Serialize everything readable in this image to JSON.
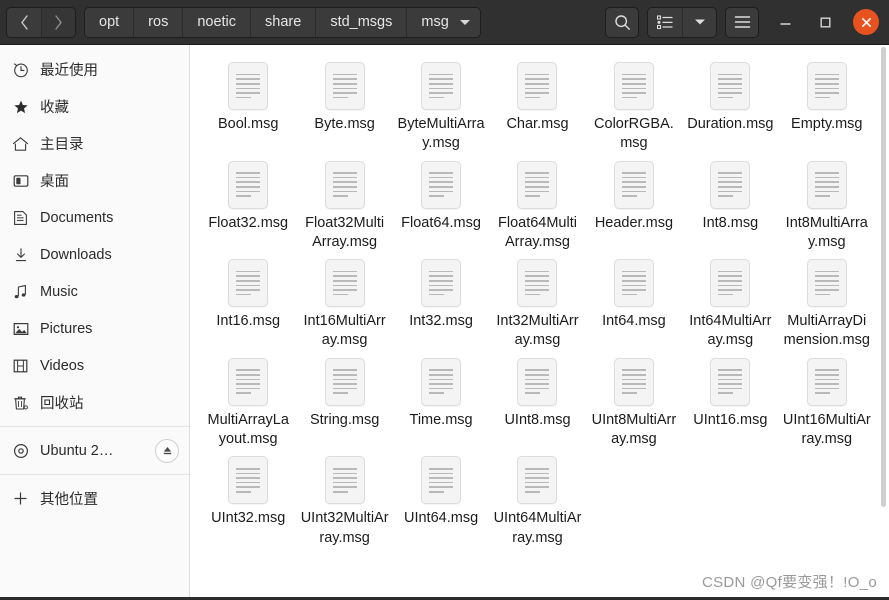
{
  "window": {
    "title": "msg",
    "nav": {
      "back_label": "‹",
      "forward_label": "›"
    },
    "breadcrumb": [
      "opt",
      "ros",
      "noetic",
      "share",
      "std_msgs",
      "msg"
    ],
    "toolbar": {
      "search_icon": "search-icon",
      "view_list_icon": "view-list-icon",
      "view_dropdown_icon": "chevron-down-icon",
      "menu_icon": "hamburger-menu-icon"
    },
    "controls": {
      "minimize": "–",
      "maximize": "□",
      "close": "✕"
    },
    "accent_color": "#e8521f",
    "headerbar_color": "#303030"
  },
  "sidebar": {
    "items": [
      {
        "label": "最近使用",
        "icon": "clock-icon"
      },
      {
        "label": "收藏",
        "icon": "star-icon"
      },
      {
        "label": "主目录",
        "icon": "home-icon"
      },
      {
        "label": "桌面",
        "icon": "desktop-icon"
      },
      {
        "label": "Documents",
        "icon": "documents-icon"
      },
      {
        "label": "Downloads",
        "icon": "download-icon"
      },
      {
        "label": "Music",
        "icon": "music-note-icon"
      },
      {
        "label": "Pictures",
        "icon": "picture-icon"
      },
      {
        "label": "Videos",
        "icon": "video-film-icon"
      },
      {
        "label": "回收站",
        "icon": "trash-icon"
      }
    ],
    "devices": [
      {
        "label": "Ubuntu 2…",
        "icon": "disc-icon",
        "eject": "eject-icon"
      }
    ],
    "other": {
      "label": "其他位置",
      "icon": "plus-icon"
    }
  },
  "files": [
    "Bool.msg",
    "Byte.msg",
    "ByteMultiArray.msg",
    "Char.msg",
    "ColorRGBA.msg",
    "Duration.msg",
    "Empty.msg",
    "Float32.msg",
    "Float32MultiArray.msg",
    "Float64.msg",
    "Float64MultiArray.msg",
    "Header.msg",
    "Int8.msg",
    "Int8MultiArray.msg",
    "Int16.msg",
    "Int16MultiArray.msg",
    "Int32.msg",
    "Int32MultiArray.msg",
    "Int64.msg",
    "Int64MultiArray.msg",
    "MultiArrayDimension.msg",
    "MultiArrayLayout.msg",
    "String.msg",
    "Time.msg",
    "UInt8.msg",
    "UInt8MultiArray.msg",
    "UInt16.msg",
    "UInt16MultiArray.msg",
    "UInt32.msg",
    "UInt32MultiArray.msg",
    "UInt64.msg",
    "UInt64MultiArray.msg"
  ],
  "watermark": "CSDN @Qf要变强！!O_o"
}
